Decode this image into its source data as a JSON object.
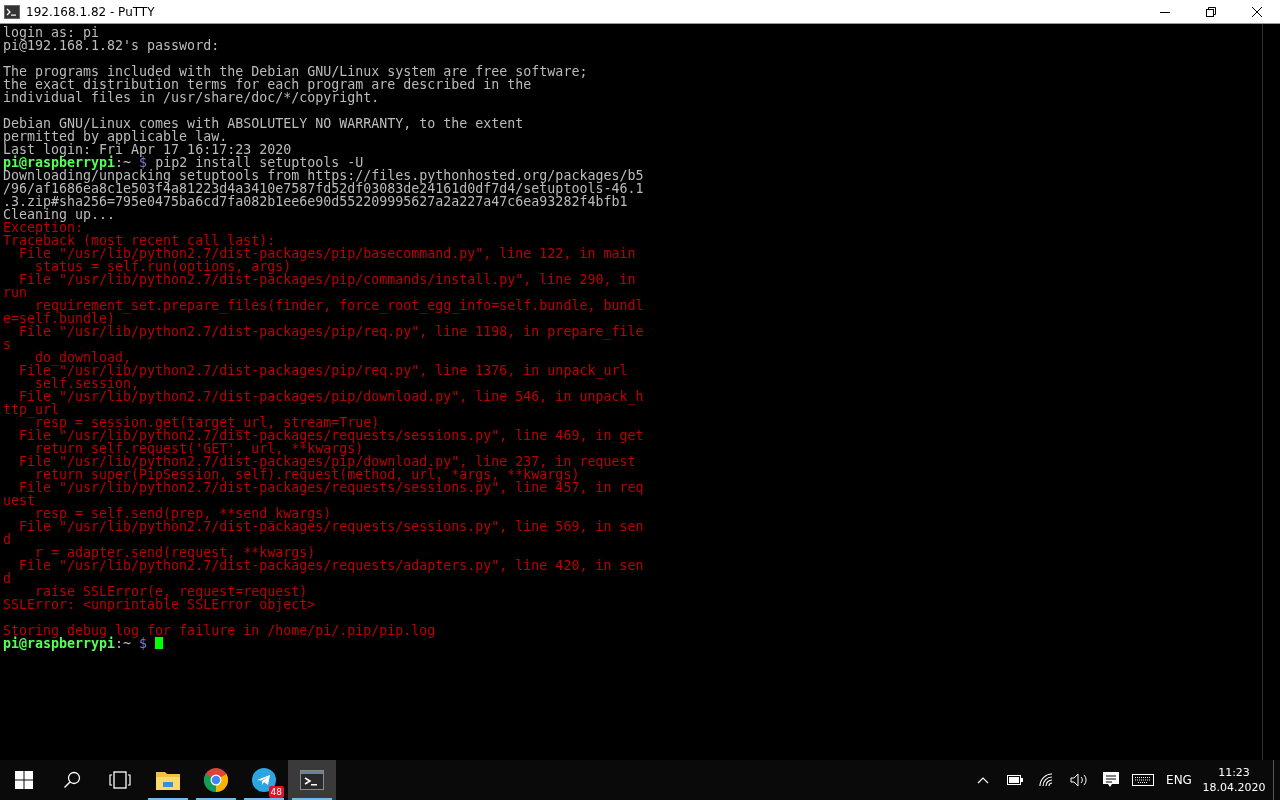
{
  "window": {
    "title": "192.168.1.82 - PuTTY"
  },
  "terminal": {
    "lines": [
      {
        "kind": "text",
        "text": "login as: pi"
      },
      {
        "kind": "text",
        "text": "pi@192.168.1.82's password:"
      },
      {
        "kind": "blank"
      },
      {
        "kind": "text",
        "text": "The programs included with the Debian GNU/Linux system are free software;"
      },
      {
        "kind": "text",
        "text": "the exact distribution terms for each program are described in the"
      },
      {
        "kind": "text",
        "text": "individual files in /usr/share/doc/*/copyright."
      },
      {
        "kind": "blank"
      },
      {
        "kind": "text",
        "text": "Debian GNU/Linux comes with ABSOLUTELY NO WARRANTY, to the extent"
      },
      {
        "kind": "text",
        "text": "permitted by applicable law."
      },
      {
        "kind": "text",
        "text": "Last login: Fri Apr 17 16:17:23 2020"
      },
      {
        "kind": "prompt",
        "user": "pi@raspberrypi",
        "path": ":~",
        "symbol": "$",
        "command": "pip2 install setuptools -U",
        "cursor": false
      },
      {
        "kind": "text",
        "text": "Downloading/unpacking setuptools from https://files.pythonhosted.org/packages/b5"
      },
      {
        "kind": "text",
        "text": "/96/af1686ea8c1e503f4a81223d4a3410e7587fd52df03083de24161d0df7d4/setuptools-46.1"
      },
      {
        "kind": "text",
        "text": ".3.zip#sha256=795e0475ba6cd7fa082b1ee6e90d552209995627a2a227a47c6ea93282f4bfb1"
      },
      {
        "kind": "text",
        "text": "Cleaning up..."
      },
      {
        "kind": "error",
        "text": "Exception:"
      },
      {
        "kind": "error",
        "text": "Traceback (most recent call last):"
      },
      {
        "kind": "error",
        "text": "  File \"/usr/lib/python2.7/dist-packages/pip/basecommand.py\", line 122, in main"
      },
      {
        "kind": "error",
        "text": "    status = self.run(options, args)"
      },
      {
        "kind": "error",
        "text": "  File \"/usr/lib/python2.7/dist-packages/pip/commands/install.py\", line 290, in"
      },
      {
        "kind": "error",
        "text": "run"
      },
      {
        "kind": "error",
        "text": "    requirement_set.prepare_files(finder, force_root_egg_info=self.bundle, bundl"
      },
      {
        "kind": "error",
        "text": "e=self.bundle)"
      },
      {
        "kind": "error",
        "text": "  File \"/usr/lib/python2.7/dist-packages/pip/req.py\", line 1198, in prepare_file"
      },
      {
        "kind": "error",
        "text": "s"
      },
      {
        "kind": "error",
        "text": "    do_download,"
      },
      {
        "kind": "error",
        "text": "  File \"/usr/lib/python2.7/dist-packages/pip/req.py\", line 1376, in unpack_url"
      },
      {
        "kind": "error",
        "text": "    self.session,"
      },
      {
        "kind": "error",
        "text": "  File \"/usr/lib/python2.7/dist-packages/pip/download.py\", line 546, in unpack_h"
      },
      {
        "kind": "error",
        "text": "ttp_url"
      },
      {
        "kind": "error",
        "text": "    resp = session.get(target_url, stream=True)"
      },
      {
        "kind": "error",
        "text": "  File \"/usr/lib/python2.7/dist-packages/requests/sessions.py\", line 469, in get"
      },
      {
        "kind": "error",
        "text": "    return self.request('GET', url, **kwargs)"
      },
      {
        "kind": "error",
        "text": "  File \"/usr/lib/python2.7/dist-packages/pip/download.py\", line 237, in request"
      },
      {
        "kind": "error",
        "text": "    return super(PipSession, self).request(method, url, *args, **kwargs)"
      },
      {
        "kind": "error",
        "text": "  File \"/usr/lib/python2.7/dist-packages/requests/sessions.py\", line 457, in req"
      },
      {
        "kind": "error",
        "text": "uest"
      },
      {
        "kind": "error",
        "text": "    resp = self.send(prep, **send_kwargs)"
      },
      {
        "kind": "error",
        "text": "  File \"/usr/lib/python2.7/dist-packages/requests/sessions.py\", line 569, in sen"
      },
      {
        "kind": "error",
        "text": "d"
      },
      {
        "kind": "error",
        "text": "    r = adapter.send(request, **kwargs)"
      },
      {
        "kind": "error",
        "text": "  File \"/usr/lib/python2.7/dist-packages/requests/adapters.py\", line 420, in sen"
      },
      {
        "kind": "error",
        "text": "d"
      },
      {
        "kind": "error",
        "text": "    raise SSLError(e, request=request)"
      },
      {
        "kind": "error",
        "text": "SSLError: <unprintable SSLError object>"
      },
      {
        "kind": "blank"
      },
      {
        "kind": "error",
        "text": "Storing debug log for failure in /home/pi/.pip/pip.log"
      },
      {
        "kind": "prompt",
        "user": "pi@raspberrypi",
        "path": ":~",
        "symbol": "$",
        "cursor": true
      }
    ]
  },
  "taskbar": {
    "apps": [
      {
        "kind": "explorer",
        "running": true,
        "selected": false
      },
      {
        "kind": "browser",
        "running": true,
        "selected": false
      },
      {
        "kind": "messenger",
        "running": true,
        "selected": false,
        "badge": "48"
      },
      {
        "kind": "terminal",
        "running": true,
        "selected": true
      }
    ],
    "language": "ENG",
    "time": "11:23",
    "date": "18.04.2020"
  }
}
